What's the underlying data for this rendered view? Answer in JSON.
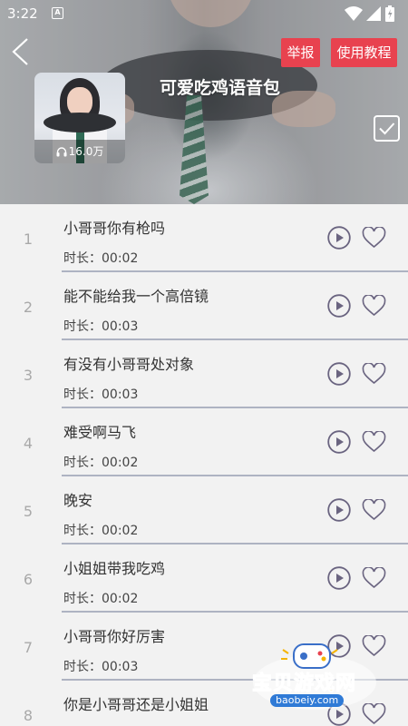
{
  "status_bar": {
    "time": "3:22",
    "notif_icon": "A"
  },
  "header": {
    "title": "可爱吃鸡语音包",
    "report_label": "举报",
    "tutorial_label": "使用教程",
    "play_count": "16.0万"
  },
  "colors": {
    "accent": "#e8424f",
    "icon": "#6a6480",
    "divider": "#aeb3c2"
  },
  "list": [
    {
      "num": "1",
      "name": "小哥哥你有枪吗",
      "duration": "时长：00:02"
    },
    {
      "num": "2",
      "name": "能不能给我一个高倍镜",
      "duration": "时长：00:03"
    },
    {
      "num": "3",
      "name": "有没有小哥哥处对象",
      "duration": "时长：00:03"
    },
    {
      "num": "4",
      "name": "难受啊马飞",
      "duration": "时长：00:02"
    },
    {
      "num": "5",
      "name": "晚安",
      "duration": "时长：00:02"
    },
    {
      "num": "6",
      "name": "小姐姐带我吃鸡",
      "duration": "时长：00:02"
    },
    {
      "num": "7",
      "name": "小哥哥你好厉害",
      "duration": "时长：00:03"
    },
    {
      "num": "8",
      "name": "你是小哥哥还是小姐姐",
      "duration": ""
    }
  ],
  "watermark": {
    "text": "宝贝游戏网",
    "url": "baobeiy.com"
  }
}
